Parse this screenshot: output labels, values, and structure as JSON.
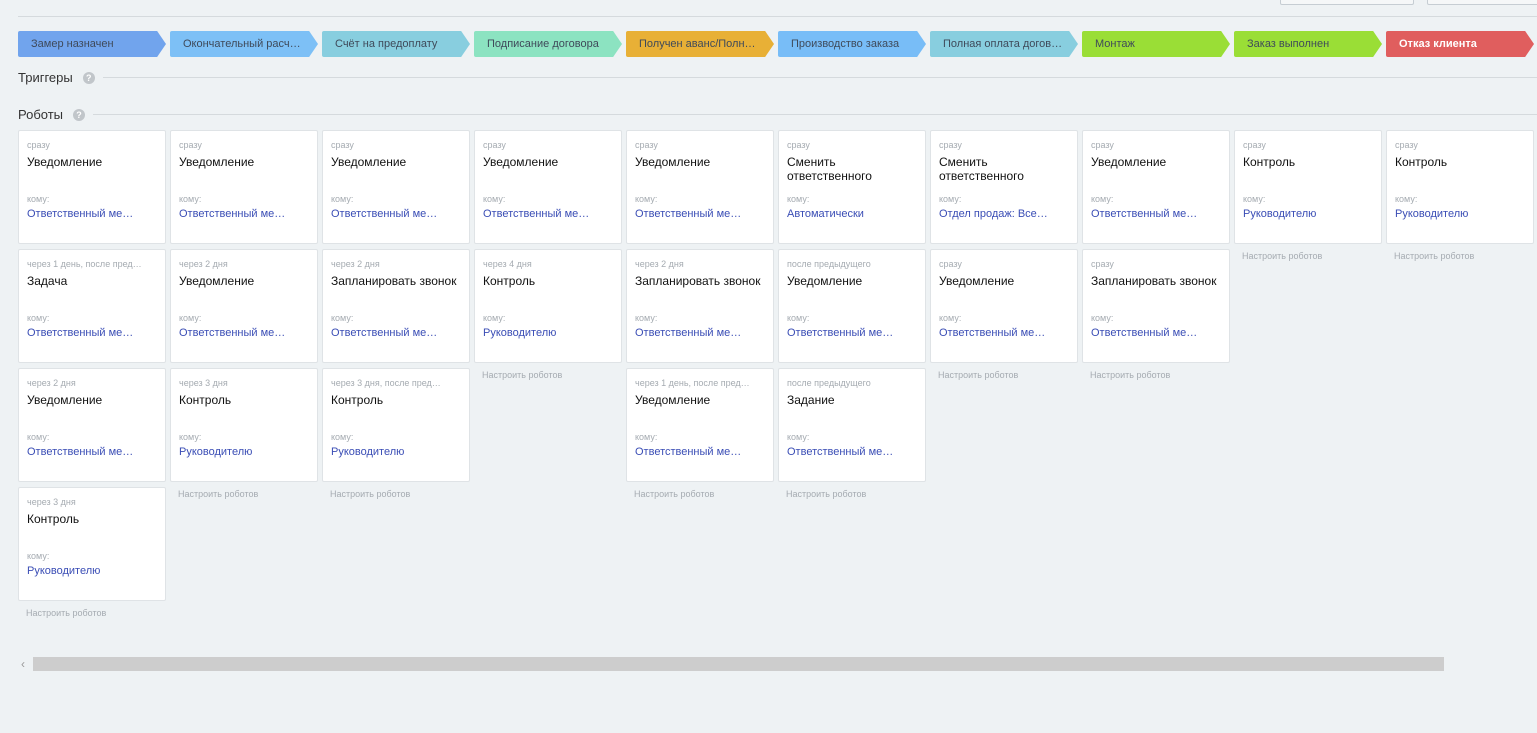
{
  "stages": [
    {
      "label": "Замер назначен",
      "color": "#71a4ed",
      "text": "#3f4a5a"
    },
    {
      "label": "Окончательный расч…",
      "color": "#7dc0f6",
      "text": "#3f4a5a"
    },
    {
      "label": "Счёт на предоплату",
      "color": "#88cedf",
      "text": "#3f4a5a"
    },
    {
      "label": "Подписание договора",
      "color": "#8ce3c1",
      "text": "#3f4a5a"
    },
    {
      "label": "Получен аванс/Полн…",
      "color": "#e8b036",
      "text": "#3f4a5a"
    },
    {
      "label": "Производство заказа",
      "color": "#78bdf7",
      "text": "#3f4a5a"
    },
    {
      "label": "Полная оплата догов…",
      "color": "#88cedf",
      "text": "#3f4a5a"
    },
    {
      "label": "Монтаж",
      "color": "#9ade36",
      "text": "#3f4a5a"
    },
    {
      "label": "Заказ выполнен",
      "color": "#9ade36",
      "text": "#3f4a5a"
    },
    {
      "label": "Отказ клиента",
      "color": "#e05e5e",
      "text": "#ffffff"
    }
  ],
  "sections": {
    "triggers": "Триггеры",
    "robots": "Роботы",
    "help": "?"
  },
  "to_label": "кому:",
  "setup_label": "Настроить роботов",
  "columns": [
    [
      {
        "when": "сразу",
        "title": "Уведомление",
        "who": "Ответственный ме…"
      },
      {
        "when": "через 1 день, после пред…",
        "title": "Задача",
        "who": "Ответственный ме…"
      },
      {
        "when": "через 2 дня",
        "title": "Уведомление",
        "who": "Ответственный ме…"
      },
      {
        "when": "через 3 дня",
        "title": "Контроль",
        "who": "Руководителю"
      }
    ],
    [
      {
        "when": "сразу",
        "title": "Уведомление",
        "who": "Ответственный ме…"
      },
      {
        "when": "через 2 дня",
        "title": "Уведомление",
        "who": "Ответственный ме…"
      },
      {
        "when": "через 3 дня",
        "title": "Контроль",
        "who": "Руководителю"
      }
    ],
    [
      {
        "when": "сразу",
        "title": "Уведомление",
        "who": "Ответственный ме…"
      },
      {
        "when": "через 2 дня",
        "title": "Запланировать звонок",
        "who": "Ответственный ме…"
      },
      {
        "when": "через 3 дня, после пред…",
        "title": "Контроль",
        "who": "Руководителю"
      }
    ],
    [
      {
        "when": "сразу",
        "title": "Уведомление",
        "who": "Ответственный ме…"
      },
      {
        "when": "через 4 дня",
        "title": "Контроль",
        "who": "Руководителю"
      }
    ],
    [
      {
        "when": "сразу",
        "title": "Уведомление",
        "who": "Ответственный ме…"
      },
      {
        "when": "через 2 дня",
        "title": "Запланировать звонок",
        "who": "Ответственный ме…"
      },
      {
        "when": "через 1 день, после пред…",
        "title": "Уведомление",
        "who": "Ответственный ме…"
      }
    ],
    [
      {
        "when": "сразу",
        "title": "Сменить ответственного",
        "who": "Автоматически"
      },
      {
        "when": "после предыдущего",
        "title": "Уведомление",
        "who": "Ответственный ме…"
      },
      {
        "when": "после предыдущего",
        "title": "Задание",
        "who": "Ответственный ме…"
      }
    ],
    [
      {
        "when": "сразу",
        "title": "Сменить ответственного",
        "who": "Отдел продаж: Все…"
      },
      {
        "when": "сразу",
        "title": "Уведомление",
        "who": "Ответственный ме…"
      }
    ],
    [
      {
        "when": "сразу",
        "title": "Уведомление",
        "who": "Ответственный ме…"
      },
      {
        "when": "сразу",
        "title": "Запланировать звонок",
        "who": "Ответственный ме…"
      }
    ],
    [
      {
        "when": "сразу",
        "title": "Контроль",
        "who": "Руководителю"
      }
    ],
    [
      {
        "when": "сразу",
        "title": "Контроль",
        "who": "Руководителю"
      }
    ]
  ],
  "scroll_left": "‹"
}
